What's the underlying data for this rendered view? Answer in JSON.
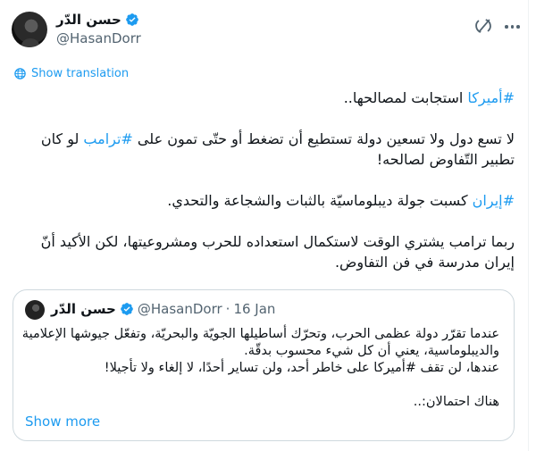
{
  "author": {
    "display_name": "حسن الدّر",
    "handle": "@HasanDorr"
  },
  "icons": {
    "verified": "verified-badge-icon",
    "grok": "grok-icon",
    "more": "more-options-icon",
    "globe": "globe-icon",
    "accent_color": "#1d9bf0"
  },
  "show_translation_label": "Show translation",
  "tweet": {
    "p1_tag": "#أميركا",
    "p1_text": " استجابت لمصالحها..",
    "p2_pre": "لا تسع دول ولا تسعين دولة تستطيع أن تضغط أو حتّى تمون على ",
    "p2_tag": "#ترامب",
    "p2_post": " لو كان تطبير التّفاوض لصالحه!",
    "p3_tag": "#إيران",
    "p3_text": " كسبت جولة ديبلوماسيّة بالثبات والشجاعة والتحدي.",
    "p4_text": "ربما ترامب يشتري الوقت لاستكمال استعداده للحرب ومشروعيتها، لكن الأكيد أنّ إيران مدرسة في فن التفاوض."
  },
  "quote": {
    "name": "حسن الدّر",
    "handle": "@HasanDorr",
    "separator": "·",
    "date": "16 Jan",
    "line1": "عندما تقرّر دولة عظمى الحرب، وتحرّك أساطيلها الجويّة والبحريّة، وتفعّل جيوشها الإعلامية",
    "line2": "والديبلوماسية، يعني أن كل شيء محسوب بدقّة.",
    "line3": "عندها، لن تقف #أميركا على خاطر أحد، ولن تساير أحدًا، لا إلغاء ولا تأجيلا!",
    "line4": "هناك احتمالان:..",
    "show_more": "Show more"
  }
}
